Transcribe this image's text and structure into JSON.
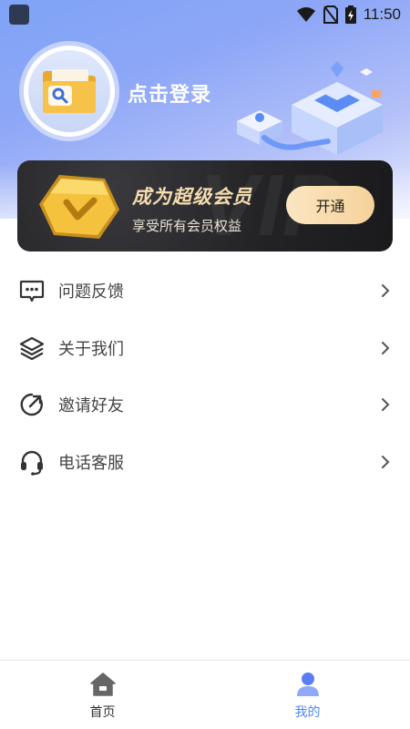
{
  "status_bar": {
    "time": "11:50"
  },
  "profile": {
    "login_text": "点击登录"
  },
  "vip": {
    "watermark": "VIP",
    "title": "成为超级会员",
    "subtitle": "享受所有会员权益",
    "button_label": "开通"
  },
  "menu": {
    "items": [
      {
        "label": "问题反馈",
        "icon": "feedback-icon"
      },
      {
        "label": "关于我们",
        "icon": "layers-icon"
      },
      {
        "label": "邀请好友",
        "icon": "share-icon"
      },
      {
        "label": "电话客服",
        "icon": "headset-icon"
      }
    ]
  },
  "bottom_nav": {
    "items": [
      {
        "label": "首页",
        "icon": "home-icon"
      },
      {
        "label": "我的",
        "icon": "user-icon",
        "active": true
      }
    ]
  },
  "colors": {
    "accent": "#4e86f5",
    "vip_gold": "#f5dcae",
    "header_blue": "#7fa3f6"
  }
}
